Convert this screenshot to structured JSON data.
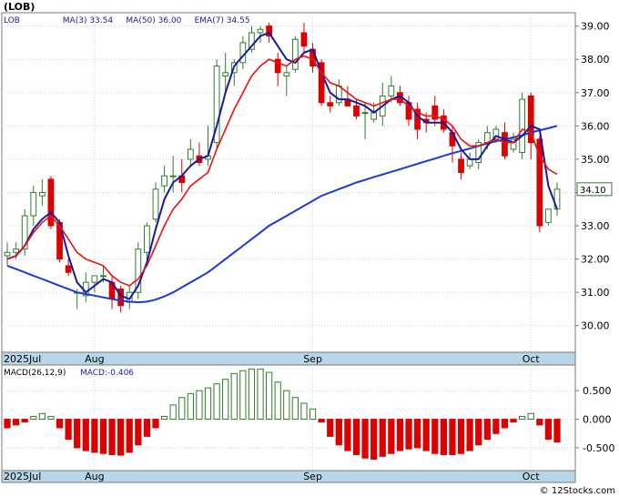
{
  "header": {
    "ticker": "(LOB)",
    "legend": [
      {
        "label": "LOB",
        "color": "#1a1a9a"
      },
      {
        "label": "MA(3)",
        "value": "33.54",
        "color": "#1a1a9a"
      },
      {
        "label": "MA(50)",
        "value": "36.00",
        "color": "#1a1a9a"
      },
      {
        "label": "EMA(7)",
        "value": "34.55",
        "color": "#1a1a9a"
      }
    ]
  },
  "price_panel": {
    "ylim": [
      29.2,
      39.4
    ],
    "ticks": [
      30,
      31,
      32,
      33,
      34,
      35,
      36,
      37,
      38,
      39
    ],
    "tick_labels": [
      "30.00",
      "31.00",
      "32.00",
      "33.00",
      "34.00",
      "35.00",
      "36.00",
      "37.00",
      "38.00",
      "39.00"
    ],
    "last_price_label": "34.10"
  },
  "macd_panel": {
    "label": "MACD(26,12,9)",
    "value_text": "MACD:-0.406",
    "ylim": [
      -0.9,
      0.95
    ],
    "ticks": [
      0.5,
      0.0,
      -0.5
    ],
    "tick_labels": [
      "0.500",
      "0.000",
      "-0.500"
    ]
  },
  "x_axis": {
    "labels": [
      {
        "label": "2025Jul",
        "index": 0
      },
      {
        "label": "Aug",
        "index": 10
      },
      {
        "label": "Sep",
        "index": 35
      },
      {
        "label": "Oct",
        "index": 60
      }
    ]
  },
  "footer": {
    "credit": "© 12Stocks.com"
  },
  "colors": {
    "up": "#2e7d2e",
    "down": "#dd0000",
    "ma": "#1a1a9a",
    "ma50": "#1a3ad6",
    "ema": "#ee1111",
    "panel_bg": "#b7d7e8"
  },
  "chart_data": {
    "type": "candlestick",
    "series": [
      {
        "name": "OHLC",
        "columns": [
          "open",
          "high",
          "low",
          "close"
        ],
        "values": [
          [
            32.1,
            32.5,
            31.8,
            32.2
          ],
          [
            32.2,
            32.5,
            32.0,
            32.3
          ],
          [
            32.3,
            33.5,
            32.1,
            33.3
          ],
          [
            33.3,
            34.2,
            33.0,
            34.0
          ],
          [
            33.9,
            34.4,
            33.6,
            34.0
          ],
          [
            34.4,
            34.5,
            32.9,
            33.0
          ],
          [
            33.1,
            33.2,
            31.9,
            32.0
          ],
          [
            31.8,
            32.0,
            31.5,
            31.6
          ],
          [
            31.0,
            31.1,
            30.5,
            31.0
          ],
          [
            30.9,
            31.6,
            30.7,
            31.3
          ],
          [
            31.3,
            31.5,
            31.0,
            31.5
          ],
          [
            31.5,
            31.8,
            31.3,
            31.5
          ],
          [
            31.3,
            31.5,
            30.5,
            30.8
          ],
          [
            31.1,
            31.2,
            30.4,
            30.6
          ],
          [
            30.7,
            31.2,
            30.5,
            31.0
          ],
          [
            31.0,
            32.5,
            30.8,
            32.3
          ],
          [
            32.2,
            33.1,
            31.9,
            33.0
          ],
          [
            33.2,
            34.3,
            33.1,
            34.1
          ],
          [
            34.2,
            34.8,
            34.0,
            34.5
          ],
          [
            34.5,
            35.1,
            34.0,
            34.5
          ],
          [
            34.5,
            35.0,
            34.0,
            34.3
          ],
          [
            35.0,
            35.6,
            34.8,
            35.3
          ],
          [
            35.1,
            35.5,
            34.8,
            34.9
          ],
          [
            35.0,
            36.0,
            34.8,
            35.1
          ],
          [
            35.5,
            38.0,
            35.3,
            37.8
          ],
          [
            37.5,
            38.2,
            37.0,
            37.6
          ],
          [
            37.6,
            38.0,
            37.2,
            37.9
          ],
          [
            37.9,
            38.7,
            37.7,
            38.5
          ],
          [
            38.3,
            39.0,
            38.2,
            38.8
          ],
          [
            38.8,
            39.0,
            38.5,
            38.9
          ],
          [
            39.0,
            39.1,
            38.5,
            38.7
          ],
          [
            38.0,
            38.2,
            37.2,
            37.6
          ],
          [
            37.5,
            37.8,
            36.9,
            37.6
          ],
          [
            37.7,
            38.7,
            37.6,
            38.6
          ],
          [
            38.8,
            39.1,
            38.2,
            38.4
          ],
          [
            38.3,
            38.5,
            37.6,
            37.8
          ],
          [
            37.9,
            38.0,
            36.6,
            36.7
          ],
          [
            36.7,
            36.9,
            36.4,
            36.6
          ],
          [
            36.7,
            37.4,
            36.6,
            37.2
          ],
          [
            36.8,
            37.2,
            36.6,
            36.6
          ],
          [
            36.6,
            36.8,
            36.2,
            36.3
          ],
          [
            36.4,
            36.7,
            35.6,
            36.4
          ],
          [
            36.2,
            36.7,
            36.1,
            36.4
          ],
          [
            36.3,
            37.3,
            36.0,
            36.9
          ],
          [
            36.9,
            37.5,
            36.7,
            37.2
          ],
          [
            37.0,
            37.2,
            36.6,
            36.7
          ],
          [
            36.7,
            36.9,
            36.0,
            36.2
          ],
          [
            36.5,
            36.7,
            35.6,
            35.9
          ],
          [
            36.2,
            36.4,
            35.8,
            36.1
          ],
          [
            36.6,
            36.9,
            36.0,
            36.2
          ],
          [
            36.3,
            36.5,
            35.8,
            35.9
          ],
          [
            35.8,
            36.0,
            34.9,
            35.4
          ],
          [
            35.0,
            35.2,
            34.4,
            34.6
          ],
          [
            34.8,
            35.2,
            34.7,
            35.0
          ],
          [
            34.9,
            35.6,
            34.7,
            35.5
          ],
          [
            35.5,
            36.0,
            35.3,
            35.8
          ],
          [
            35.6,
            36.0,
            35.5,
            35.9
          ],
          [
            35.8,
            36.1,
            35.0,
            35.1
          ],
          [
            35.3,
            35.8,
            35.2,
            35.6
          ],
          [
            35.2,
            37.0,
            35.0,
            36.8
          ],
          [
            36.9,
            37.0,
            35.0,
            35.5
          ],
          [
            35.6,
            35.7,
            32.8,
            33.0
          ],
          [
            33.1,
            33.5,
            33.0,
            33.5
          ],
          [
            33.5,
            34.3,
            33.3,
            34.1
          ]
        ]
      },
      {
        "name": "MA(3)",
        "values": [
          32.0,
          32.1,
          32.4,
          32.9,
          33.2,
          33.4,
          33.1,
          32.1,
          31.3,
          31.0,
          31.2,
          31.4,
          31.3,
          30.9,
          30.8,
          31.2,
          31.9,
          32.9,
          33.8,
          34.3,
          34.5,
          34.8,
          35.0,
          35.1,
          36.0,
          37.0,
          37.8,
          38.1,
          38.4,
          38.7,
          38.8,
          38.4,
          38.0,
          37.9,
          38.2,
          38.3,
          37.6,
          37.0,
          36.8,
          36.8,
          36.7,
          36.6,
          36.4,
          36.6,
          36.8,
          36.9,
          36.7,
          36.3,
          36.1,
          36.1,
          36.1,
          35.8,
          35.3,
          35.0,
          35.0,
          35.4,
          35.7,
          35.6,
          35.5,
          35.7,
          36.0,
          35.9,
          34.2,
          33.5
        ]
      },
      {
        "name": "MA(50)",
        "values": [
          31.8,
          31.7,
          31.6,
          31.5,
          31.4,
          31.3,
          31.2,
          31.1,
          31.0,
          30.95,
          30.9,
          30.85,
          30.8,
          30.75,
          30.72,
          30.7,
          30.72,
          30.78,
          30.88,
          31.0,
          31.15,
          31.3,
          31.45,
          31.6,
          31.8,
          32.0,
          32.2,
          32.4,
          32.6,
          32.8,
          33.0,
          33.15,
          33.3,
          33.45,
          33.6,
          33.75,
          33.9,
          34.0,
          34.1,
          34.2,
          34.3,
          34.38,
          34.46,
          34.54,
          34.62,
          34.7,
          34.78,
          34.86,
          34.94,
          35.02,
          35.1,
          35.18,
          35.25,
          35.32,
          35.4,
          35.47,
          35.54,
          35.6,
          35.66,
          35.72,
          35.8,
          35.87,
          35.93,
          36.0
        ]
      },
      {
        "name": "EMA(7)",
        "values": [
          32.0,
          32.1,
          32.4,
          32.8,
          33.1,
          33.3,
          33.0,
          32.6,
          32.2,
          32.0,
          31.9,
          31.8,
          31.5,
          31.3,
          31.2,
          31.4,
          31.8,
          32.4,
          33.0,
          33.5,
          33.8,
          34.2,
          34.4,
          34.6,
          35.3,
          35.9,
          36.5,
          37.0,
          37.5,
          37.8,
          38.0,
          37.9,
          37.8,
          38.0,
          38.1,
          38.0,
          37.6,
          37.3,
          37.2,
          37.0,
          36.8,
          36.7,
          36.6,
          36.7,
          36.8,
          36.8,
          36.6,
          36.4,
          36.3,
          36.3,
          36.2,
          36.0,
          35.6,
          35.4,
          35.4,
          35.5,
          35.6,
          35.5,
          35.5,
          35.9,
          35.8,
          35.1,
          34.7,
          34.55
        ]
      },
      {
        "name": "MACD",
        "values": [
          -0.15,
          -0.1,
          -0.05,
          0.05,
          0.1,
          0.05,
          -0.15,
          -0.35,
          -0.5,
          -0.55,
          -0.58,
          -0.6,
          -0.62,
          -0.63,
          -0.58,
          -0.45,
          -0.3,
          -0.15,
          0.05,
          0.25,
          0.38,
          0.45,
          0.5,
          0.55,
          0.62,
          0.7,
          0.8,
          0.85,
          0.88,
          0.88,
          0.82,
          0.65,
          0.5,
          0.38,
          0.28,
          0.18,
          -0.05,
          -0.3,
          -0.45,
          -0.55,
          -0.62,
          -0.68,
          -0.7,
          -0.65,
          -0.6,
          -0.55,
          -0.52,
          -0.5,
          -0.55,
          -0.6,
          -0.62,
          -0.62,
          -0.6,
          -0.55,
          -0.45,
          -0.35,
          -0.25,
          -0.15,
          -0.05,
          0.05,
          0.1,
          -0.1,
          -0.35,
          -0.4
        ]
      }
    ]
  }
}
